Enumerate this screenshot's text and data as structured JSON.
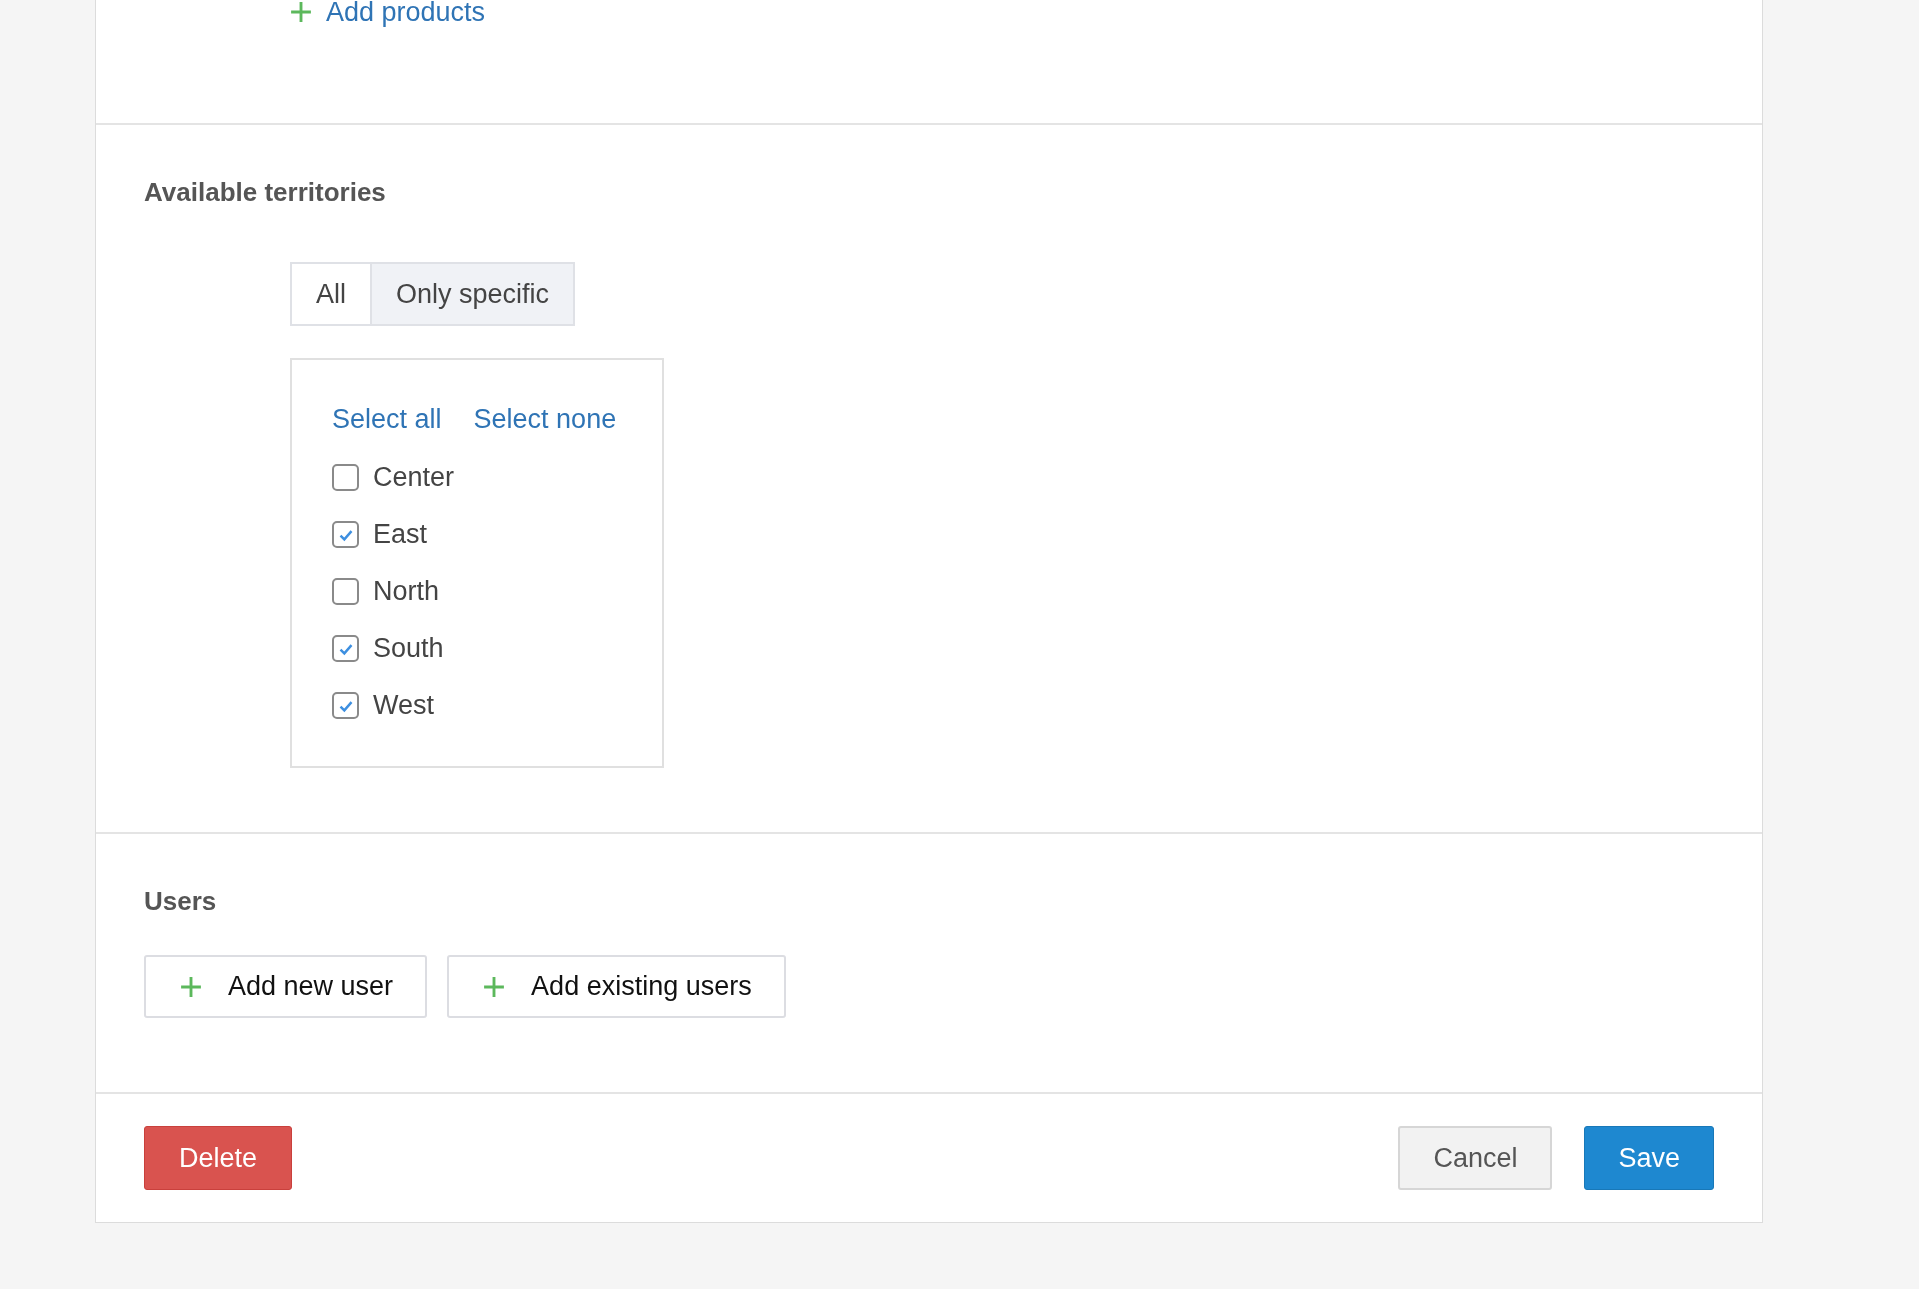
{
  "products_section": {
    "add_link": "Add products"
  },
  "territories_section": {
    "title": "Available territories",
    "mode_options": [
      {
        "label": "All",
        "selected": false
      },
      {
        "label": "Only specific",
        "selected": true
      }
    ],
    "select_all": "Select all",
    "select_none": "Select none",
    "territories": [
      {
        "label": "Center",
        "checked": false
      },
      {
        "label": "East",
        "checked": true
      },
      {
        "label": "North",
        "checked": false
      },
      {
        "label": "South",
        "checked": true
      },
      {
        "label": "West",
        "checked": true
      }
    ]
  },
  "users_section": {
    "title": "Users",
    "buttons": [
      "Add new user",
      "Add existing users"
    ]
  },
  "footer": {
    "delete": "Delete",
    "cancel": "Cancel",
    "save": "Save"
  }
}
